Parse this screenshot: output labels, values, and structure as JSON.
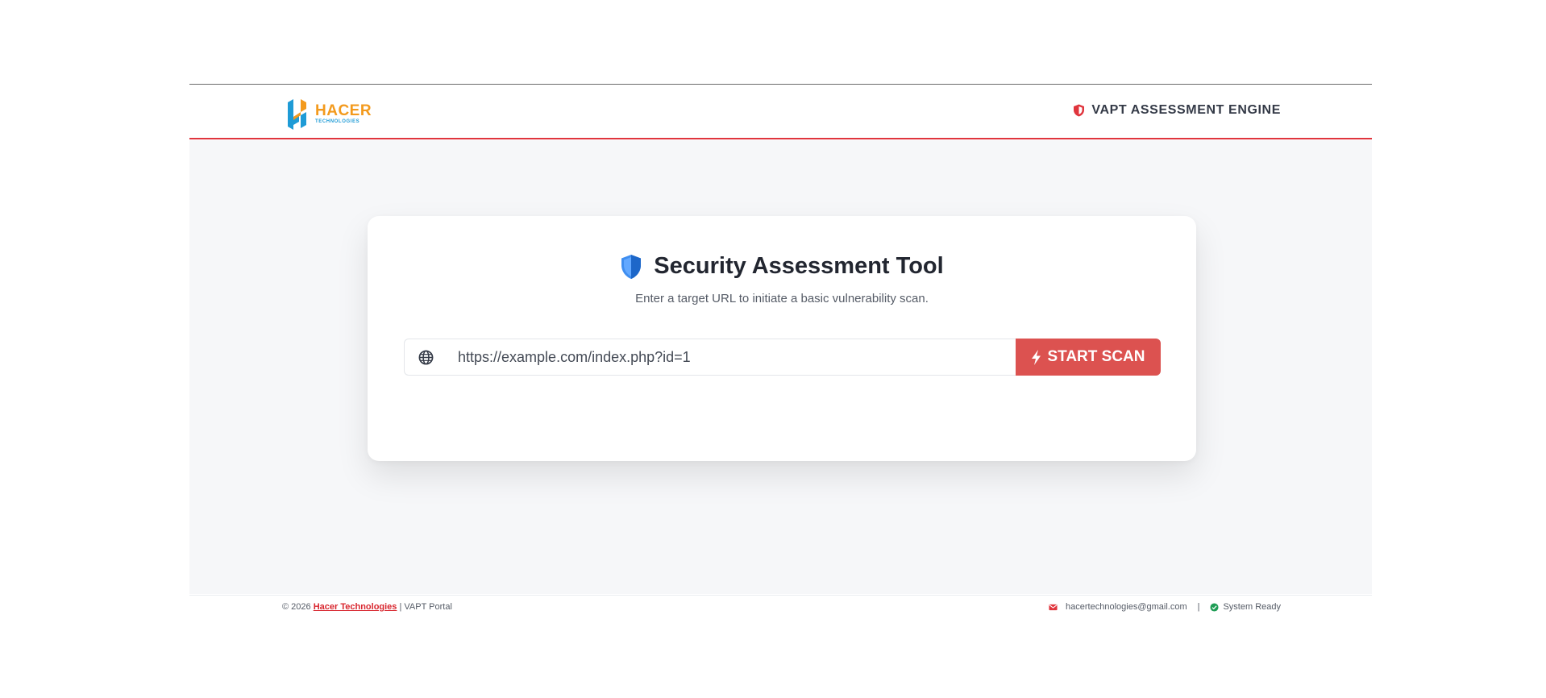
{
  "header": {
    "logo": {
      "name": "HACER",
      "sub": "TECHNOLOGIES",
      "colors": {
        "orange": "#f39a1d",
        "blue": "#1e9bd6"
      },
      "icon": "hacer-logo-icon"
    },
    "engine_label": "VAPT ASSESSMENT ENGINE",
    "engine_icon": "shield-icon"
  },
  "card": {
    "title": "Security Assessment Tool",
    "title_icon": "shield-half-icon",
    "subtitle": "Enter a target URL to initiate a basic vulnerability scan.",
    "url_input": {
      "icon": "globe-icon",
      "value": "https://example.com/index.php?id=1"
    },
    "scan_button": {
      "label": "START SCAN",
      "icon": "bolt-icon",
      "color": "#dc5250"
    }
  },
  "footer": {
    "copyright_prefix": "© 2026",
    "company_link": "Hacer Technologies",
    "portal": "| VAPT Portal",
    "email_icon": "envelope-icon",
    "email": "hacertechnologies@gmail.com",
    "separator": "|",
    "status_icon": "check-circle-icon",
    "status": "System Ready",
    "status_color": "#1f9d55"
  },
  "theme": {
    "accent": "#e0353d",
    "page_bg": "#f6f7f9"
  }
}
